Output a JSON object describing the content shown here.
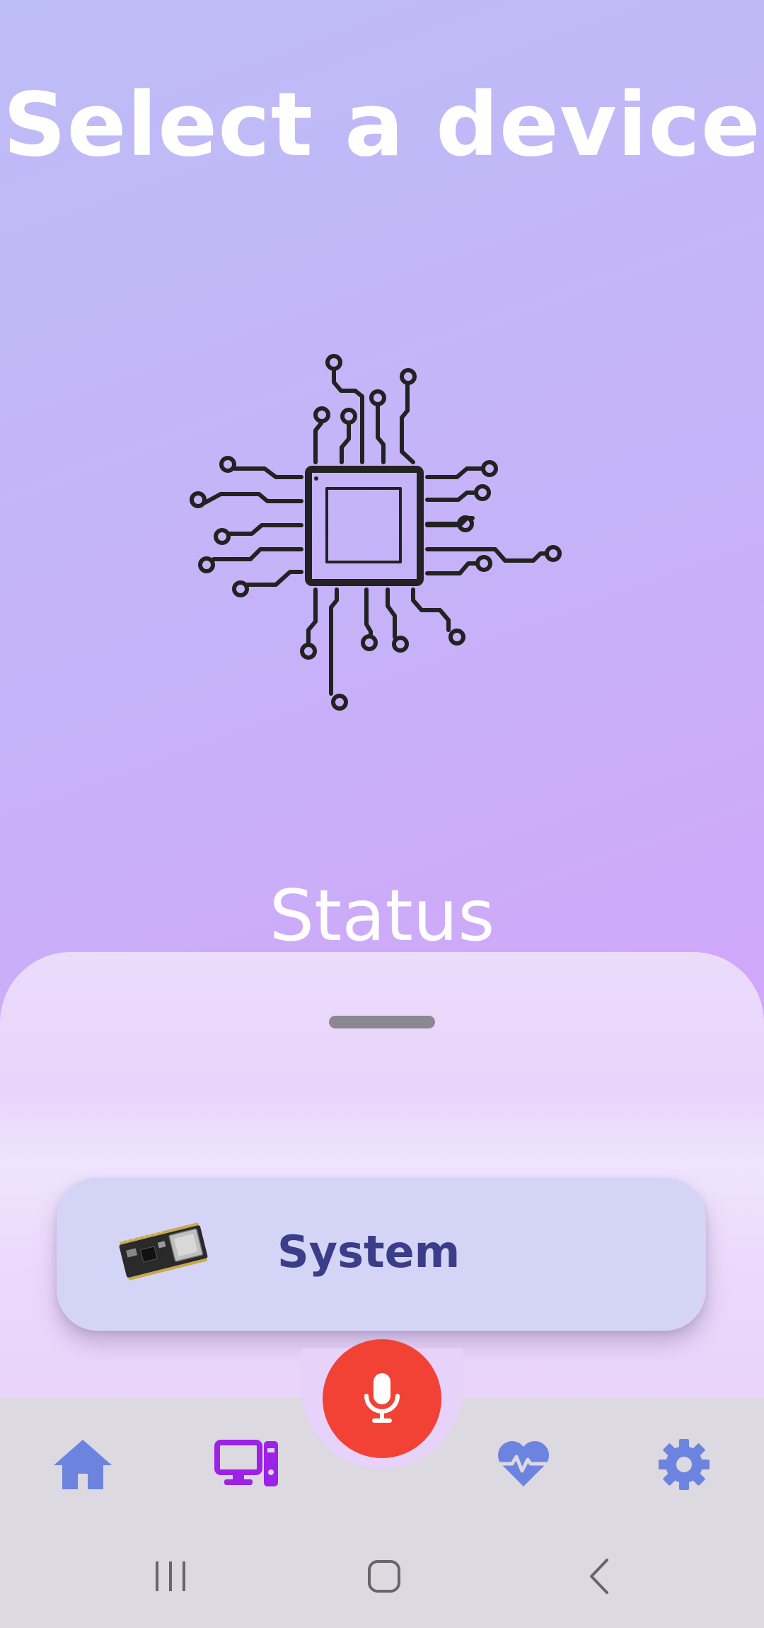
{
  "header": {
    "title": "Select a device"
  },
  "status": {
    "label": "Status"
  },
  "device_list": [
    {
      "label": "System",
      "image": "esp32-board-image"
    }
  ],
  "bottom_nav": {
    "items": [
      "home-icon",
      "devices-icon",
      "mic-icon",
      "health-heart-icon",
      "settings-gear-icon"
    ],
    "active": "devices-icon",
    "colors": {
      "inactive": "#6d83e0",
      "active": "#9b22e6",
      "mic": "#f24236"
    }
  },
  "system_nav": [
    "recent-apps-icon",
    "home-button-icon",
    "back-icon"
  ]
}
